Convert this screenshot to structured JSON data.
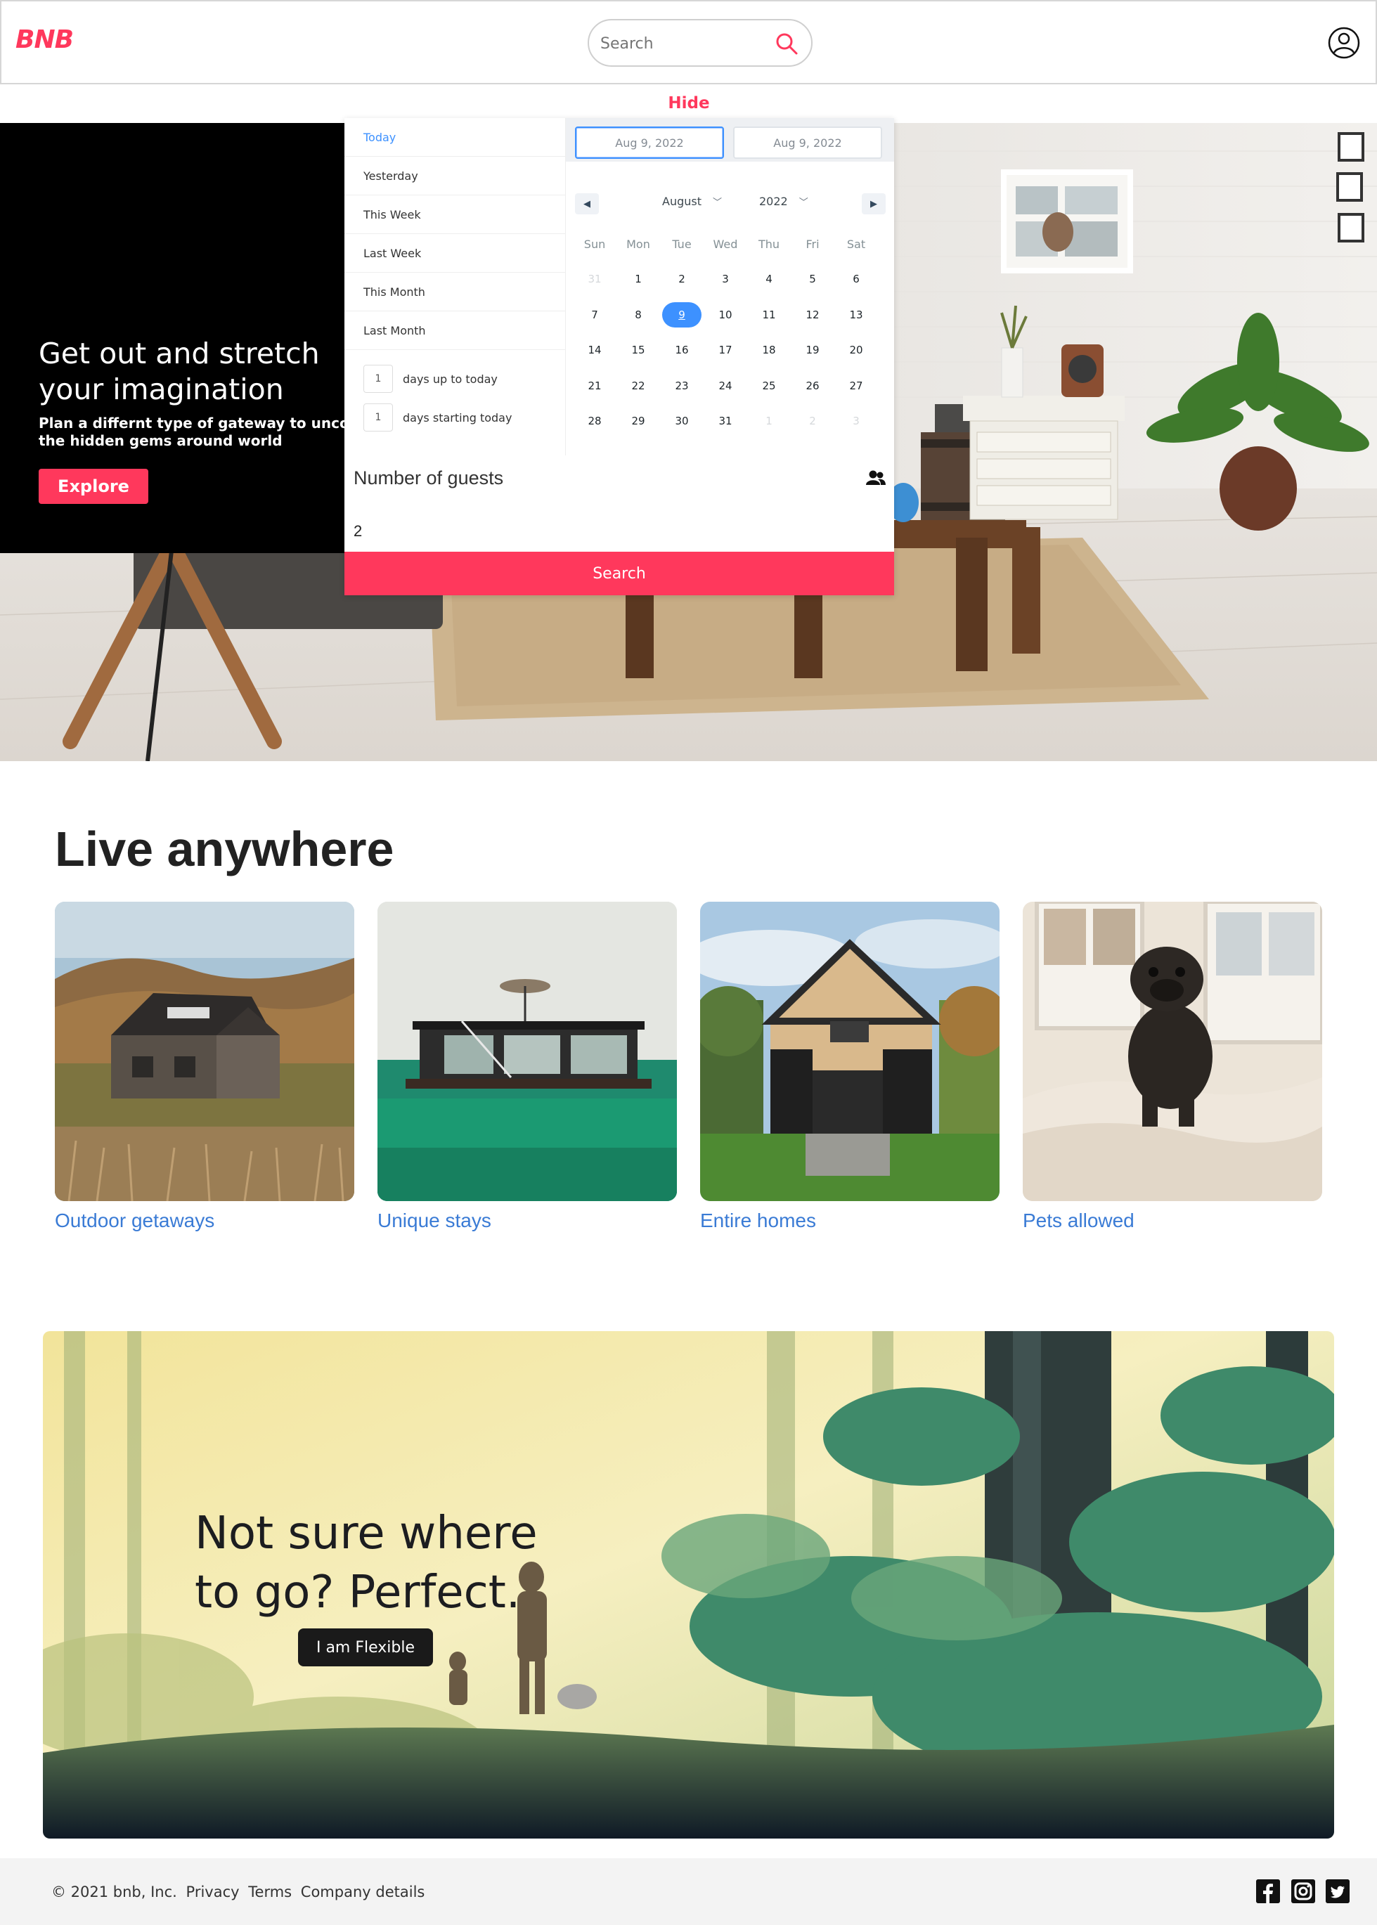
{
  "header": {
    "logo": "BNB",
    "search_placeholder": "Search",
    "hide_label": "Hide"
  },
  "hero": {
    "title": "Get out and stretch your imagination",
    "description": "Plan a differnt type of gateway to uncover the hidden gems around world",
    "explore_label": "Explore"
  },
  "date_picker": {
    "ranges": [
      "Today",
      "Yesterday",
      "This Week",
      "Last Week",
      "This Month",
      "Last Month"
    ],
    "active_range": "Today",
    "days_up_value": "1",
    "days_up_label": "days up to today",
    "days_start_value": "1",
    "days_start_label": "days starting today",
    "start_date": "Aug 9, 2022",
    "end_date": "Aug 9, 2022",
    "month": "August",
    "year": "2022",
    "weekdays": [
      "Sun",
      "Mon",
      "Tue",
      "Wed",
      "Thu",
      "Fri",
      "Sat"
    ],
    "weeks": [
      [
        "31",
        "1",
        "2",
        "3",
        "4",
        "5",
        "6"
      ],
      [
        "7",
        "8",
        "9",
        "10",
        "11",
        "12",
        "13"
      ],
      [
        "14",
        "15",
        "16",
        "17",
        "18",
        "19",
        "20"
      ],
      [
        "21",
        "22",
        "23",
        "24",
        "25",
        "26",
        "27"
      ],
      [
        "28",
        "29",
        "30",
        "31",
        "1",
        "2",
        "3"
      ]
    ],
    "selected_day": "9"
  },
  "guests": {
    "label": "Number of guests",
    "value": "2",
    "search_label": "Search"
  },
  "live_anywhere": {
    "title": "Live anywhere",
    "cards": [
      {
        "label": "Outdoor getaways"
      },
      {
        "label": "Unique stays"
      },
      {
        "label": "Entire homes"
      },
      {
        "label": "Pets allowed"
      }
    ]
  },
  "banner": {
    "title": "Not sure where to go? Perfect.",
    "button_label": "I am Flexible"
  },
  "footer": {
    "copyright": "© 2021 bnb, Inc.",
    "links": [
      "Privacy",
      "Terms",
      "Company details"
    ],
    "social_icons": [
      "facebook-icon",
      "instagram-icon",
      "twitter-icon"
    ]
  },
  "colors": {
    "brand": "#ff385c",
    "accent_blue": "#3d91ff",
    "link_blue": "#3a7bd5"
  }
}
